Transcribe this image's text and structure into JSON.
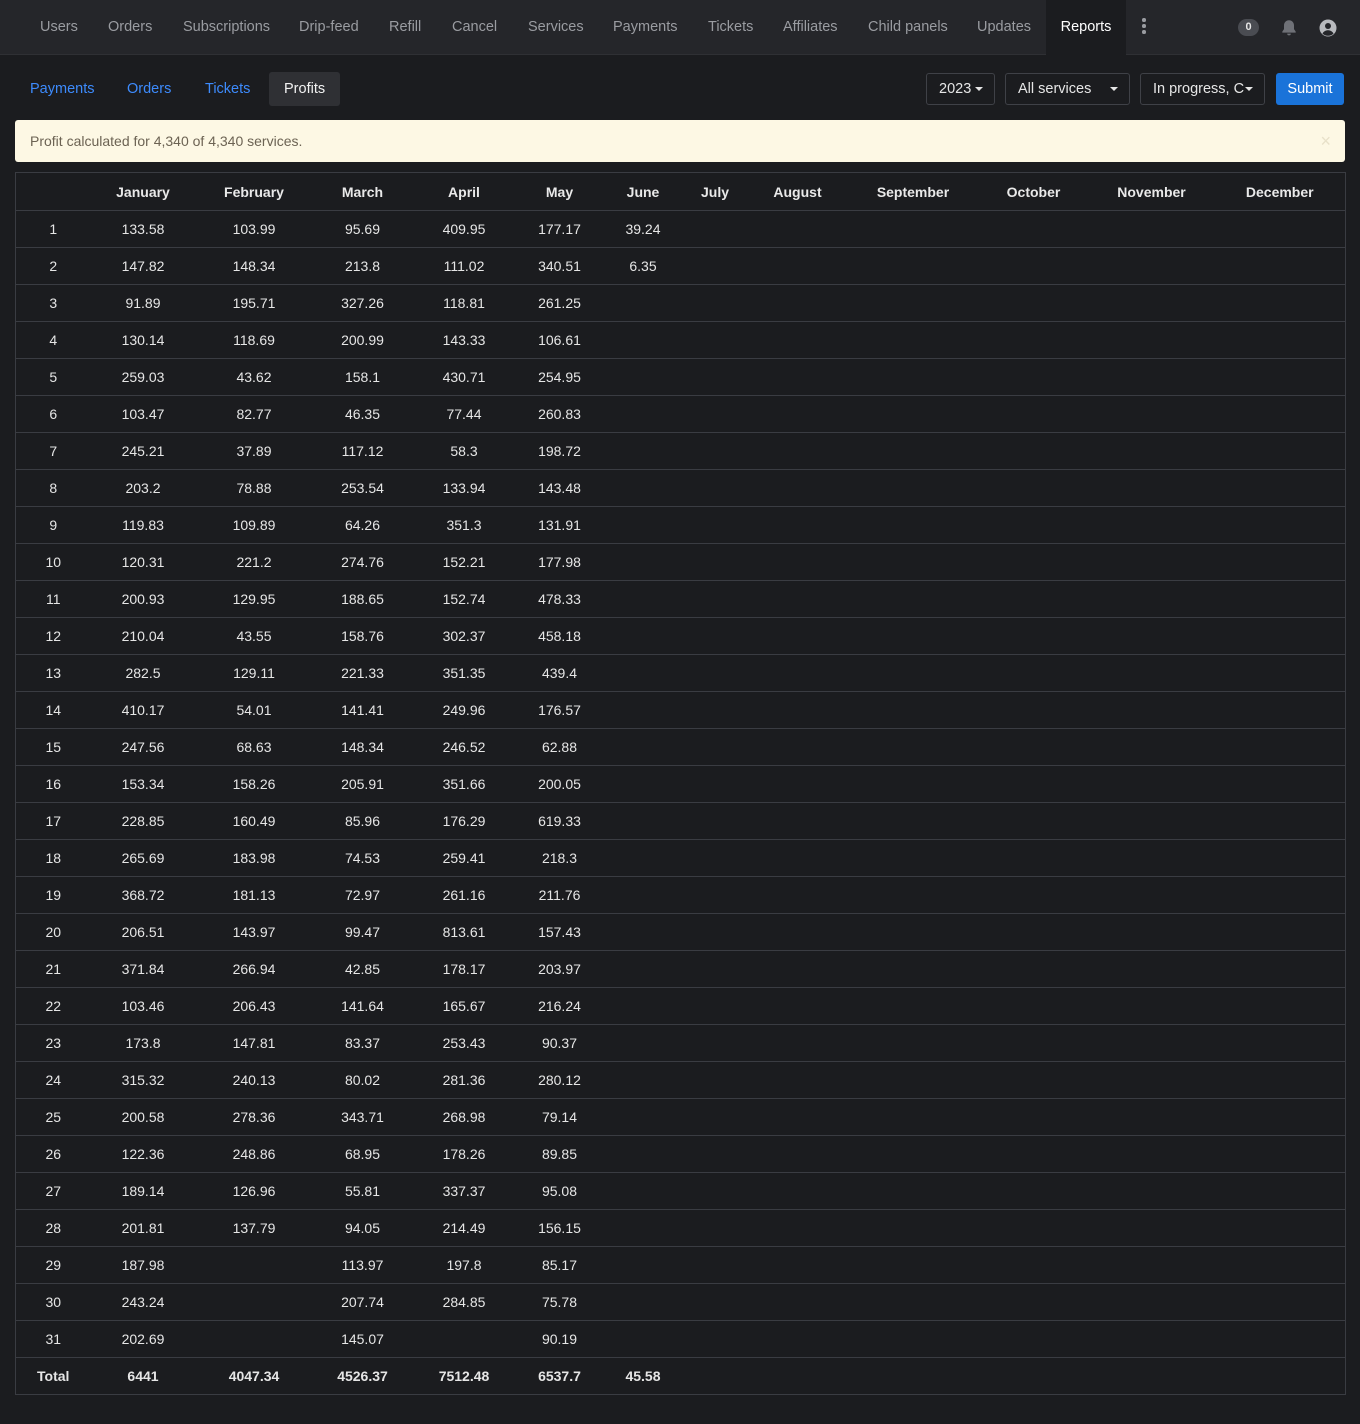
{
  "topnav": {
    "items": [
      "Users",
      "Orders",
      "Subscriptions",
      "Drip-feed",
      "Refill",
      "Cancel",
      "Services",
      "Payments",
      "Tickets",
      "Affiliates",
      "Child panels",
      "Updates"
    ],
    "active": "Reports",
    "badge_count": "0"
  },
  "subtabs": [
    "Payments",
    "Orders",
    "Tickets",
    "Profits"
  ],
  "filters": {
    "year": "2023",
    "services": "All services",
    "status": "In progress, C",
    "submit": "Submit"
  },
  "alert": {
    "text": "Profit calculated for 4,340 of 4,340 services.",
    "close": "×"
  },
  "table": {
    "months": [
      "January",
      "February",
      "March",
      "April",
      "May",
      "June",
      "July",
      "August",
      "September",
      "October",
      "November",
      "December"
    ],
    "rows": [
      [
        "1",
        "133.58",
        "103.99",
        "95.69",
        "409.95",
        "177.17",
        "39.24",
        "",
        "",
        "",
        "",
        "",
        ""
      ],
      [
        "2",
        "147.82",
        "148.34",
        "213.8",
        "111.02",
        "340.51",
        "6.35",
        "",
        "",
        "",
        "",
        "",
        ""
      ],
      [
        "3",
        "91.89",
        "195.71",
        "327.26",
        "118.81",
        "261.25",
        "",
        "",
        "",
        "",
        "",
        "",
        ""
      ],
      [
        "4",
        "130.14",
        "118.69",
        "200.99",
        "143.33",
        "106.61",
        "",
        "",
        "",
        "",
        "",
        "",
        ""
      ],
      [
        "5",
        "259.03",
        "43.62",
        "158.1",
        "430.71",
        "254.95",
        "",
        "",
        "",
        "",
        "",
        "",
        ""
      ],
      [
        "6",
        "103.47",
        "82.77",
        "46.35",
        "77.44",
        "260.83",
        "",
        "",
        "",
        "",
        "",
        "",
        ""
      ],
      [
        "7",
        "245.21",
        "37.89",
        "117.12",
        "58.3",
        "198.72",
        "",
        "",
        "",
        "",
        "",
        "",
        ""
      ],
      [
        "8",
        "203.2",
        "78.88",
        "253.54",
        "133.94",
        "143.48",
        "",
        "",
        "",
        "",
        "",
        "",
        ""
      ],
      [
        "9",
        "119.83",
        "109.89",
        "64.26",
        "351.3",
        "131.91",
        "",
        "",
        "",
        "",
        "",
        "",
        ""
      ],
      [
        "10",
        "120.31",
        "221.2",
        "274.76",
        "152.21",
        "177.98",
        "",
        "",
        "",
        "",
        "",
        "",
        ""
      ],
      [
        "11",
        "200.93",
        "129.95",
        "188.65",
        "152.74",
        "478.33",
        "",
        "",
        "",
        "",
        "",
        "",
        ""
      ],
      [
        "12",
        "210.04",
        "43.55",
        "158.76",
        "302.37",
        "458.18",
        "",
        "",
        "",
        "",
        "",
        "",
        ""
      ],
      [
        "13",
        "282.5",
        "129.11",
        "221.33",
        "351.35",
        "439.4",
        "",
        "",
        "",
        "",
        "",
        "",
        ""
      ],
      [
        "14",
        "410.17",
        "54.01",
        "141.41",
        "249.96",
        "176.57",
        "",
        "",
        "",
        "",
        "",
        "",
        ""
      ],
      [
        "15",
        "247.56",
        "68.63",
        "148.34",
        "246.52",
        "62.88",
        "",
        "",
        "",
        "",
        "",
        "",
        ""
      ],
      [
        "16",
        "153.34",
        "158.26",
        "205.91",
        "351.66",
        "200.05",
        "",
        "",
        "",
        "",
        "",
        "",
        ""
      ],
      [
        "17",
        "228.85",
        "160.49",
        "85.96",
        "176.29",
        "619.33",
        "",
        "",
        "",
        "",
        "",
        "",
        ""
      ],
      [
        "18",
        "265.69",
        "183.98",
        "74.53",
        "259.41",
        "218.3",
        "",
        "",
        "",
        "",
        "",
        "",
        ""
      ],
      [
        "19",
        "368.72",
        "181.13",
        "72.97",
        "261.16",
        "211.76",
        "",
        "",
        "",
        "",
        "",
        "",
        ""
      ],
      [
        "20",
        "206.51",
        "143.97",
        "99.47",
        "813.61",
        "157.43",
        "",
        "",
        "",
        "",
        "",
        "",
        ""
      ],
      [
        "21",
        "371.84",
        "266.94",
        "42.85",
        "178.17",
        "203.97",
        "",
        "",
        "",
        "",
        "",
        "",
        ""
      ],
      [
        "22",
        "103.46",
        "206.43",
        "141.64",
        "165.67",
        "216.24",
        "",
        "",
        "",
        "",
        "",
        "",
        ""
      ],
      [
        "23",
        "173.8",
        "147.81",
        "83.37",
        "253.43",
        "90.37",
        "",
        "",
        "",
        "",
        "",
        "",
        ""
      ],
      [
        "24",
        "315.32",
        "240.13",
        "80.02",
        "281.36",
        "280.12",
        "",
        "",
        "",
        "",
        "",
        "",
        ""
      ],
      [
        "25",
        "200.58",
        "278.36",
        "343.71",
        "268.98",
        "79.14",
        "",
        "",
        "",
        "",
        "",
        "",
        ""
      ],
      [
        "26",
        "122.36",
        "248.86",
        "68.95",
        "178.26",
        "89.85",
        "",
        "",
        "",
        "",
        "",
        "",
        ""
      ],
      [
        "27",
        "189.14",
        "126.96",
        "55.81",
        "337.37",
        "95.08",
        "",
        "",
        "",
        "",
        "",
        "",
        ""
      ],
      [
        "28",
        "201.81",
        "137.79",
        "94.05",
        "214.49",
        "156.15",
        "",
        "",
        "",
        "",
        "",
        "",
        ""
      ],
      [
        "29",
        "187.98",
        "",
        "113.97",
        "197.8",
        "85.17",
        "",
        "",
        "",
        "",
        "",
        "",
        ""
      ],
      [
        "30",
        "243.24",
        "",
        "207.74",
        "284.85",
        "75.78",
        "",
        "",
        "",
        "",
        "",
        "",
        ""
      ],
      [
        "31",
        "202.69",
        "",
        "145.07",
        "",
        "90.19",
        "",
        "",
        "",
        "",
        "",
        "",
        ""
      ]
    ],
    "total": [
      "Total",
      "6441",
      "4047.34",
      "4526.37",
      "7512.48",
      "6537.7",
      "45.58",
      "",
      "",
      "",
      "",
      "",
      ""
    ]
  }
}
